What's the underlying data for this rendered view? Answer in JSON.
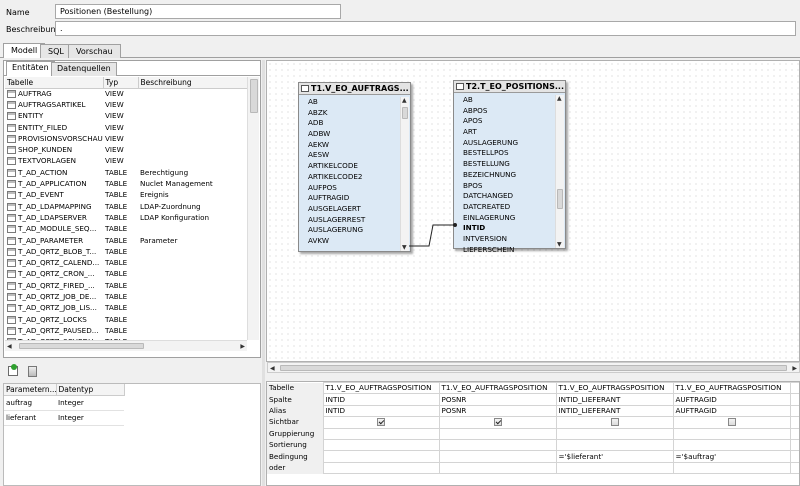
{
  "form": {
    "name_label": "Name",
    "name_value": "Positionen (Bestellung)",
    "desc_label": "Beschreibung",
    "desc_value": "."
  },
  "tabs": [
    "Modell",
    "SQL",
    "Vorschau"
  ],
  "subtabs": [
    "Entitäten",
    "Datenquellen"
  ],
  "entity_table": {
    "headers": [
      "Tabelle",
      "Typ",
      "Beschreibung"
    ],
    "rows": [
      [
        "AUFTRAG",
        "VIEW",
        ""
      ],
      [
        "AUFTRAGSARTIKEL",
        "VIEW",
        ""
      ],
      [
        "ENTITY",
        "VIEW",
        ""
      ],
      [
        "ENTITY_FILED",
        "VIEW",
        ""
      ],
      [
        "PROVISIONSVORSCHAU",
        "VIEW",
        ""
      ],
      [
        "SHOP_KUNDEN",
        "VIEW",
        ""
      ],
      [
        "TEXTVORLAGEN",
        "VIEW",
        ""
      ],
      [
        "T_AD_ACTION",
        "TABLE",
        "Berechtigung"
      ],
      [
        "T_AD_APPLICATION",
        "TABLE",
        "Nuclet Management"
      ],
      [
        "T_AD_EVENT",
        "TABLE",
        "Ereignis"
      ],
      [
        "T_AD_LDAPMAPPING",
        "TABLE",
        "LDAP-Zuordnung"
      ],
      [
        "T_AD_LDAPSERVER",
        "TABLE",
        "LDAP Konfiguration"
      ],
      [
        "T_AD_MODULE_SEQ...",
        "TABLE",
        ""
      ],
      [
        "T_AD_PARAMETER",
        "TABLE",
        "Parameter"
      ],
      [
        "T_AD_QRTZ_BLOB_T...",
        "TABLE",
        ""
      ],
      [
        "T_AD_QRTZ_CALEND...",
        "TABLE",
        ""
      ],
      [
        "T_AD_QRTZ_CRON_...",
        "TABLE",
        ""
      ],
      [
        "T_AD_QRTZ_FIRED_...",
        "TABLE",
        ""
      ],
      [
        "T_AD_QRTZ_JOB_DE...",
        "TABLE",
        ""
      ],
      [
        "T_AD_QRTZ_JOB_LIS...",
        "TABLE",
        ""
      ],
      [
        "T_AD_QRTZ_LOCKS",
        "TABLE",
        ""
      ],
      [
        "T_AD_QRTZ_PAUSED...",
        "TABLE",
        ""
      ],
      [
        "T_AD_QRTZ_SCHEDU...",
        "TABLE",
        ""
      ]
    ]
  },
  "params": {
    "headers": [
      "Parametern...",
      "Datentyp"
    ],
    "rows": [
      [
        "auftrag",
        "Integer"
      ],
      [
        "lieferant",
        "Integer"
      ]
    ]
  },
  "entity1": {
    "title": "T1.V_EO_AUFTRAGS...",
    "fields": [
      "AB",
      "ABZK",
      "ADB",
      "ADBW",
      "AEKW",
      "AESW",
      "ARTIKELCODE",
      "ARTIKELCODE2",
      "AUFPOS",
      "AUFTRAGID",
      "AUSGELAGERT",
      "AUSLAGERREST",
      "AUSLAGERUNG",
      "AVKW"
    ]
  },
  "entity2": {
    "title": "T2.T_EO_POSITIONS...",
    "fields": [
      "AB",
      "ABPOS",
      "APOS",
      "ART",
      "AUSLAGERUNG",
      "BESTELLPOS",
      "BESTELLUNG",
      "BEZEICHNUNG",
      "BPOS",
      "DATCHANGED",
      "DATCREATED",
      "EINLAGERUNG",
      "INTID",
      "INTVERSION",
      "LIEFERSCHEIN"
    ],
    "selected": "INTID"
  },
  "grid": {
    "row_labels": [
      "Tabelle",
      "Spalte",
      "Alias",
      "Sichtbar",
      "Gruppierung",
      "Sortierung",
      "Bedingung",
      "oder"
    ],
    "columns": [
      {
        "tabelle": "T1.V_EO_AUFTRAGSPOSITION",
        "spalte": "INTID",
        "alias": "INTID",
        "sichtbar": true,
        "bedingung": ""
      },
      {
        "tabelle": "T1.V_EO_AUFTRAGSPOSITION",
        "spalte": "POSNR",
        "alias": "POSNR",
        "sichtbar": true,
        "bedingung": ""
      },
      {
        "tabelle": "T1.V_EO_AUFTRAGSPOSITION",
        "spalte": "INTID_LIEFERANT",
        "alias": "INTID_LIEFERANT",
        "sichtbar": false,
        "bedingung": "='$lieferant'"
      },
      {
        "tabelle": "T1.V_EO_AUFTRAGSPOSITION",
        "spalte": "AUFTRAGID",
        "alias": "AUFTRAGID",
        "sichtbar": false,
        "bedingung": "='$auftrag'"
      }
    ]
  },
  "icons": {
    "add": "add-parameter-icon",
    "delete": "delete-parameter-icon",
    "table": "table-icon",
    "window": "window-icon",
    "checkbox": "checkbox-icon"
  },
  "colors": {
    "entity_body": "#dce9f5",
    "entity_header": "#e4e4e4",
    "canvas_dots": "#c8c8c8"
  }
}
